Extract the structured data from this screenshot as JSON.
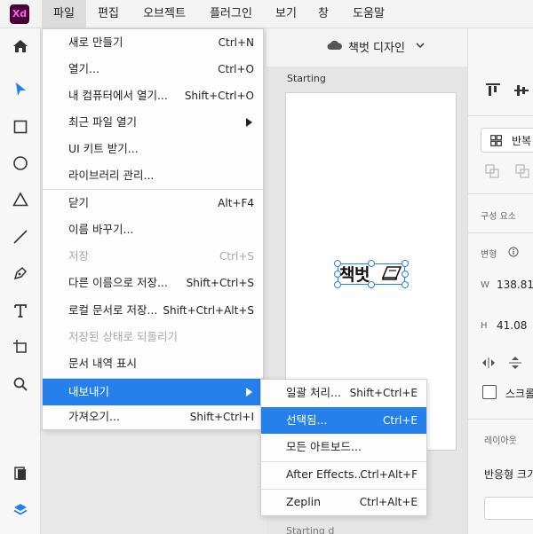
{
  "app": {
    "logo": "Xd",
    "logo_bg": "#470137",
    "logo_fg": "#ff61f6",
    "accent": "#2680eb"
  },
  "menubar": {
    "items": [
      "파일",
      "편집",
      "오브젝트",
      "플러그인",
      "보기",
      "창",
      "도움말"
    ],
    "active_index": 0
  },
  "document": {
    "title": "책벗 디자인",
    "cloud_icon": "cloud-icon"
  },
  "canvas": {
    "artboard_label": "Starting",
    "artboard_label_2": "Starting d",
    "selected_text": "책벗"
  },
  "toolbar": {
    "tools": [
      "home-icon",
      "select-icon",
      "rectangle-icon",
      "ellipse-icon",
      "triangle-icon",
      "line-icon",
      "pen-icon",
      "text-icon",
      "artboard-icon",
      "zoom-icon",
      "assets-icon",
      "layers-icon"
    ]
  },
  "file_menu": {
    "items": [
      {
        "label": "새로 만들기",
        "shortcut": "Ctrl+N"
      },
      {
        "label": "열기...",
        "shortcut": "Ctrl+O"
      },
      {
        "label": "내 컴퓨터에서 열기...",
        "shortcut": "Shift+Ctrl+O"
      },
      {
        "label": "최근 파일 열기",
        "shortcut": ""
      },
      {
        "label": "UI 키트 받기...",
        "shortcut": ""
      },
      {
        "label": "라이브러리 관리...",
        "shortcut": ""
      },
      {
        "label": "닫기",
        "shortcut": "Alt+F4"
      },
      {
        "label": "이름 바꾸기...",
        "shortcut": ""
      },
      {
        "label": "저장",
        "shortcut": "Ctrl+S"
      },
      {
        "label": "다른 이름으로 저장...",
        "shortcut": "Shift+Ctrl+S"
      },
      {
        "label": "로컬 문서로 저장...",
        "shortcut": "Shift+Ctrl+Alt+S"
      },
      {
        "label": "저장된 상태로 되돌리기",
        "shortcut": ""
      },
      {
        "label": "문서 내역 표시",
        "shortcut": ""
      },
      {
        "label": "내보내기",
        "shortcut": ""
      },
      {
        "label": "가져오기...",
        "shortcut": "Shift+Ctrl+I"
      }
    ]
  },
  "export_menu": {
    "items": [
      {
        "label": "일괄 처리...",
        "shortcut": "Shift+Ctrl+E"
      },
      {
        "label": "선택됨...",
        "shortcut": "Ctrl+E"
      },
      {
        "label": "모든 아트보드...",
        "shortcut": ""
      },
      {
        "label": "After Effects...",
        "shortcut": "Ctrl+Alt+F"
      },
      {
        "label": "Zeplin",
        "shortcut": "Ctrl+Alt+E"
      }
    ]
  },
  "right_panel": {
    "repeat_label": "반복",
    "components_label": "구성 요소",
    "transform_label": "변형",
    "w_label": "W",
    "w_value": "138.81",
    "h_label": "H",
    "h_value": "41.08",
    "scroll_label": "스크롤",
    "layout_label": "레이아웃",
    "responsive_label": "반응형 크기"
  }
}
